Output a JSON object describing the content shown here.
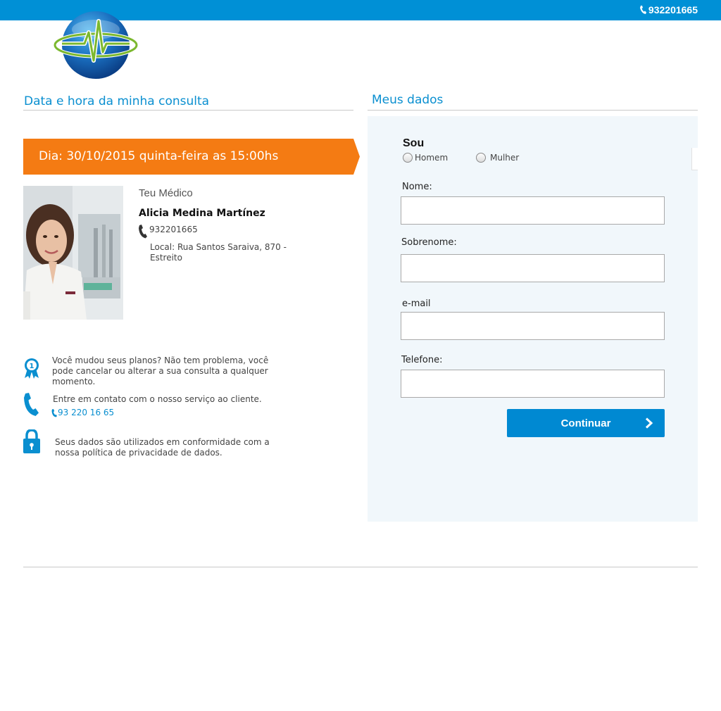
{
  "header": {
    "phone": "932201665",
    "accent_color": "#0090d6"
  },
  "appointment": {
    "section_title": "Data e hora da minha consulta",
    "banner_text": "Dia: 30/10/2015 quinta-feira as 15:00hs",
    "banner_color": "#f47b13"
  },
  "doctor": {
    "heading": "Teu Médico",
    "name": "Alicia Medina Martínez",
    "phone": "932201665",
    "local": "Local: Rua Santos Saraiva, 870 - Estreito"
  },
  "info": {
    "change_plans": "Você mudou seus planos? Não tem problema, você pode cancelar ou alterar a sua consulta a qualquer momento.",
    "contact_text": "Entre em contato com o nosso serviço ao cliente.",
    "contact_phone": "93 220 16 65",
    "privacy": "Seus dados são utilizados em conformidade com a nossa política de privacidade de dados."
  },
  "form": {
    "section_title": "Meus dados",
    "gender_label": "Sou",
    "gender_options": [
      "Homem",
      "Mulher"
    ],
    "fields": {
      "nome": {
        "label": "Nome:",
        "value": ""
      },
      "sobrenome": {
        "label": "Sobrenome:",
        "value": ""
      },
      "email": {
        "label": "e-mail",
        "value": ""
      },
      "telefone": {
        "label": "Telefone:",
        "value": ""
      }
    },
    "submit_label": "Continuar"
  },
  "icons": {
    "top_phone": "phone-icon",
    "doctor_phone": "phone-icon",
    "award": "award-ribbon-icon",
    "contact": "phone-handset-icon",
    "privacy": "lock-icon",
    "submit": "chevron-right-icon"
  }
}
